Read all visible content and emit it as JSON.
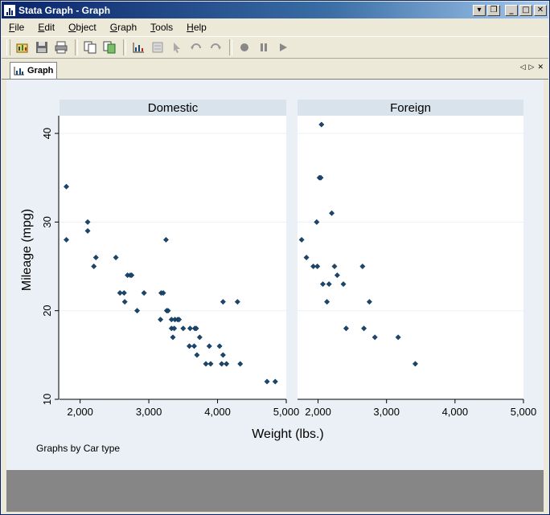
{
  "window": {
    "title": "Stata Graph - Graph"
  },
  "menu": [
    {
      "key": "F",
      "rest": "ile"
    },
    {
      "key": "E",
      "rest": "dit"
    },
    {
      "key": "O",
      "rest": "bject"
    },
    {
      "key": "G",
      "rest": "raph"
    },
    {
      "key": "T",
      "rest": "ools"
    },
    {
      "key": "H",
      "rest": "elp"
    }
  ],
  "toolbar_icons": [
    "open-graph-icon",
    "save-icon",
    "print-icon",
    "copy-icon",
    "copy-as-icon",
    "graph-editor-icon",
    "properties-icon",
    "pointer-icon",
    "undo-icon",
    "redo-icon",
    "record-icon",
    "pause-icon",
    "play-icon"
  ],
  "tab": {
    "label": "Graph"
  },
  "chart_data": {
    "type": "scatter",
    "xlabel": "Weight (lbs.)",
    "ylabel": "Mileage (mpg)",
    "note": "Graphs by Car type",
    "xlim": [
      1700,
      5000
    ],
    "ylim": [
      10,
      42
    ],
    "xticks": [
      2000,
      3000,
      4000,
      5000
    ],
    "xtick_labels": [
      "2,000",
      "3,000",
      "4,000",
      "5,000"
    ],
    "yticks": [
      10,
      20,
      30,
      40
    ],
    "ytick_labels": [
      "10",
      "20",
      "30",
      "40"
    ],
    "grid": true,
    "marker_color": "#1a476f",
    "panels": [
      {
        "name": "Domestic",
        "points": [
          [
            1800,
            34
          ],
          [
            1800,
            28
          ],
          [
            2110,
            30
          ],
          [
            2110,
            29
          ],
          [
            2200,
            25
          ],
          [
            2230,
            26
          ],
          [
            2520,
            26
          ],
          [
            2580,
            22
          ],
          [
            2640,
            22
          ],
          [
            2650,
            21
          ],
          [
            2690,
            24
          ],
          [
            2730,
            24
          ],
          [
            2750,
            24
          ],
          [
            2830,
            20
          ],
          [
            2930,
            22
          ],
          [
            3170,
            19
          ],
          [
            3180,
            22
          ],
          [
            3210,
            22
          ],
          [
            3250,
            28
          ],
          [
            3260,
            20
          ],
          [
            3280,
            20
          ],
          [
            3330,
            18
          ],
          [
            3330,
            19
          ],
          [
            3350,
            17
          ],
          [
            3370,
            18
          ],
          [
            3380,
            19
          ],
          [
            3420,
            19
          ],
          [
            3440,
            19
          ],
          [
            3500,
            18
          ],
          [
            3590,
            16
          ],
          [
            3600,
            18
          ],
          [
            3660,
            16
          ],
          [
            3670,
            18
          ],
          [
            3690,
            18
          ],
          [
            3700,
            15
          ],
          [
            3740,
            17
          ],
          [
            3830,
            14
          ],
          [
            3880,
            16
          ],
          [
            3900,
            14
          ],
          [
            4030,
            16
          ],
          [
            4060,
            14
          ],
          [
            4080,
            21
          ],
          [
            4080,
            15
          ],
          [
            4130,
            14
          ],
          [
            4290,
            21
          ],
          [
            4330,
            14
          ],
          [
            4720,
            12
          ],
          [
            4840,
            12
          ]
        ]
      },
      {
        "name": "Foreign",
        "points": [
          [
            1760,
            28
          ],
          [
            1830,
            26
          ],
          [
            1930,
            25
          ],
          [
            1980,
            30
          ],
          [
            1990,
            25
          ],
          [
            2020,
            35
          ],
          [
            2040,
            35
          ],
          [
            2050,
            41
          ],
          [
            2070,
            23
          ],
          [
            2130,
            21
          ],
          [
            2160,
            23
          ],
          [
            2200,
            31
          ],
          [
            2240,
            25
          ],
          [
            2280,
            24
          ],
          [
            2370,
            23
          ],
          [
            2410,
            18
          ],
          [
            2650,
            25
          ],
          [
            2670,
            18
          ],
          [
            2750,
            21
          ],
          [
            2830,
            17
          ],
          [
            3170,
            17
          ],
          [
            3420,
            14
          ]
        ]
      }
    ]
  }
}
